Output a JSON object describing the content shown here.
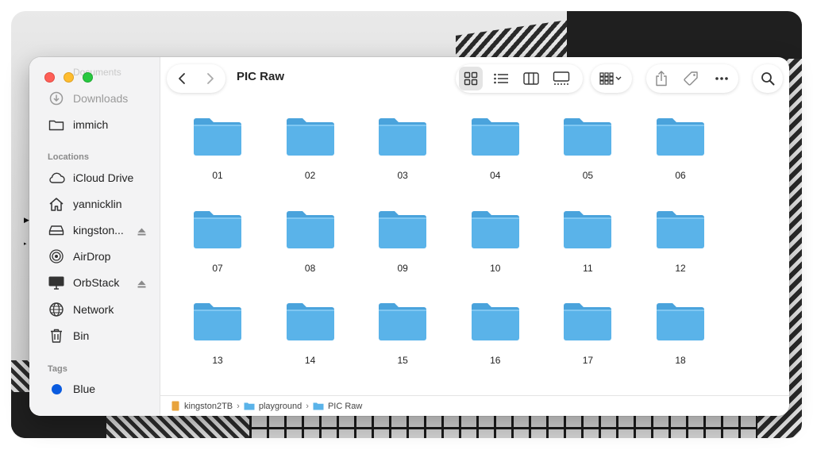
{
  "window": {
    "title": "PIC Raw"
  },
  "sidebar": {
    "ghost_item": "Documents",
    "favorites": [
      {
        "label": "Downloads",
        "icon": "download-icon",
        "faded": true
      },
      {
        "label": "immich",
        "icon": "folder-icon",
        "faded": false
      }
    ],
    "locations_header": "Locations",
    "locations": [
      {
        "label": "iCloud Drive",
        "icon": "cloud-icon"
      },
      {
        "label": "yannicklin",
        "icon": "home-icon"
      },
      {
        "label": "kingston...",
        "icon": "drive-icon",
        "eject": true
      },
      {
        "label": "AirDrop",
        "icon": "airdrop-icon"
      },
      {
        "label": "OrbStack",
        "icon": "display-icon",
        "eject": true
      },
      {
        "label": "Network",
        "icon": "globe-icon"
      },
      {
        "label": "Bin",
        "icon": "trash-icon"
      }
    ],
    "tags_header": "Tags",
    "tags": [
      {
        "label": "Blue",
        "color": "#0a5bdf"
      }
    ]
  },
  "folders": [
    "01",
    "02",
    "03",
    "04",
    "05",
    "06",
    "07",
    "08",
    "09",
    "10",
    "11",
    "12",
    "13",
    "14",
    "15",
    "16",
    "17",
    "18"
  ],
  "pathbar": {
    "items": [
      {
        "label": "kingston2TB",
        "icon": "drive-orange-icon"
      },
      {
        "label": "playground",
        "icon": "folder-icon"
      },
      {
        "label": "PIC Raw",
        "icon": "folder-icon"
      }
    ],
    "separator": "›"
  },
  "colors": {
    "folder_body": "#5ab3e9",
    "folder_tab": "#4aa3dc",
    "drive_orange": "#e8a33b",
    "tag_blue": "#0a5bdf"
  }
}
